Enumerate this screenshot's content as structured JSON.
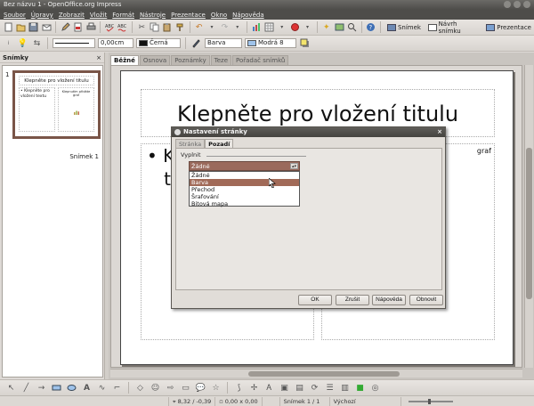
{
  "window": {
    "title": "Bez názvu 1 - OpenOffice.org Impress"
  },
  "menu": [
    "Soubor",
    "Úpravy",
    "Zobrazit",
    "Vložit",
    "Formát",
    "Nástroje",
    "Prezentace",
    "Okno",
    "Nápověda"
  ],
  "toolbar": {
    "snimek_label": "Snímek",
    "navrh_label": "Návrh snímku",
    "prezentace_label": "Prezentace"
  },
  "lineToolbar": {
    "line_width": "0,00cm",
    "line_color": "Černá",
    "area_style": "Barva",
    "area_color": "Modrá 8"
  },
  "slidesPane": {
    "title": "Snímky",
    "close": "×",
    "slide_number": "1",
    "slide_label": "Snímek 1",
    "thumb_title": "Klepněte pro vložení titulu",
    "thumb_text": "• Klepněte pro vložení textu",
    "thumb_right": "Klepnutím přidáte graf"
  },
  "viewTabs": [
    "Běžné",
    "Osnova",
    "Poznámky",
    "Teze",
    "Pořadač snímků"
  ],
  "slide": {
    "title_placeholder": "Klepněte pro vložení titulu",
    "bullet_glyph": "•",
    "text_line1": "Kl",
    "text_line2": "te",
    "right_placeholder": "graf"
  },
  "dialog": {
    "title": "Nastavení stránky",
    "close": "×",
    "tabs": [
      "Stránka",
      "Pozadí"
    ],
    "group_label": "Vyplnit",
    "selected_value": "Žádné",
    "options": [
      "Žádné",
      "Barva",
      "Přechod",
      "Šrafování",
      "Bitová mapa"
    ],
    "highlighted_option": "Barva",
    "buttons": {
      "ok": "OK",
      "cancel": "Zrušit",
      "help": "Nápověda",
      "reset": "Obnovit"
    }
  },
  "status": {
    "position": "8,32 / -0,39",
    "size": "0,00 x 0,00",
    "slide": "Snímek 1 / 1",
    "layout": "Výchozí"
  },
  "colors": {
    "accent": "#a16a58",
    "swatch_black": "#111111",
    "swatch_blue": "#9fc3ea"
  }
}
